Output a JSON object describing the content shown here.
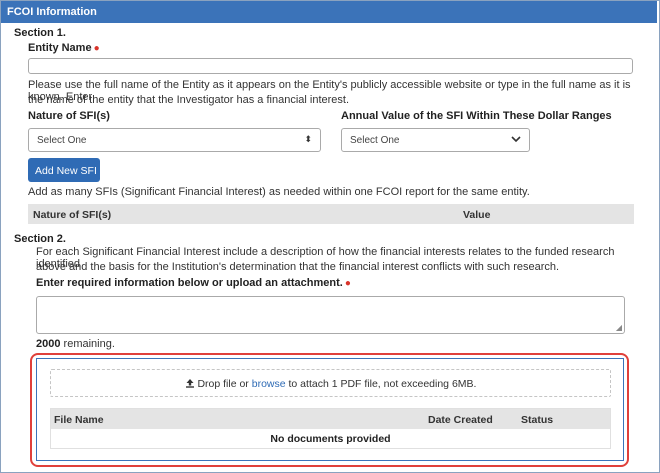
{
  "panel": {
    "title": "FCOI Information"
  },
  "section1": {
    "heading": "Section 1.",
    "entity_name_label": "Entity Name",
    "required_mark": "●",
    "entity_help_line1": "Please use the full name of the Entity as it appears on the Entity's publicly accessible website or type in the full name as it is known. Enter",
    "entity_help_line2": "the name of the entity that the Investigator has a financial interest.",
    "nature_label": "Nature of SFI(s)",
    "annual_value_label": "Annual Value of the SFI Within These  Dollar Ranges",
    "nature_select_value": "Select One",
    "annual_select_value": "Select One",
    "add_button_label": "Add New SFI",
    "add_help": "Add as many SFIs (Significant Financial Interest) as needed within one FCOI report for the same entity.",
    "table_columns": [
      "Nature of SFI(s)",
      "Value"
    ]
  },
  "section2": {
    "heading": "Section 2.",
    "desc_line1": "For each Significant Financial Interest include a description of how the financial interests relates to the funded research identified",
    "desc_line2": "above and the basis for the Institution's determination that the financial interest conflicts with such research.",
    "required_info_label": "Enter required information below or upload an attachment.",
    "remaining_count": "2000",
    "remaining_text": " remaining."
  },
  "attachment": {
    "drop_before": "Drop file or ",
    "browse_link": "browse",
    "drop_after": " to attach 1 PDF file, not exceeding 6MB.",
    "columns": [
      "File Name",
      "Date Created",
      "Status"
    ],
    "empty_message": "No documents provided"
  },
  "icons": {
    "upload": "upload-icon",
    "select_updown": "updown-arrow-icon",
    "chevron": "chevron-down-icon"
  },
  "colors": {
    "header": "#3b73b9",
    "button": "#2f6bb5",
    "required": "#d9342b",
    "highlight": "#e0403a"
  }
}
